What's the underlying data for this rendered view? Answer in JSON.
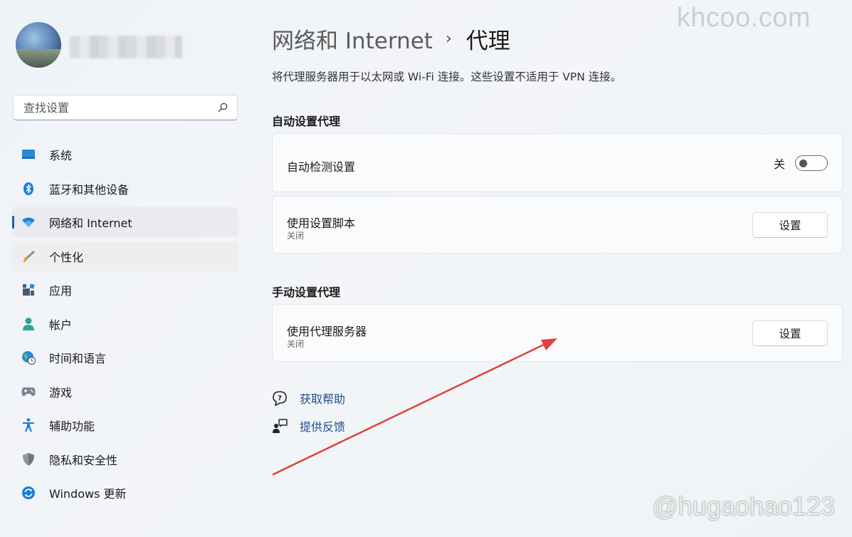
{
  "watermarks": {
    "top": "khcoo.com",
    "bottom": "@hugaohao123"
  },
  "search": {
    "placeholder": "查找设置"
  },
  "sidebar": {
    "items": [
      {
        "label": "系统",
        "icon": "monitor-icon"
      },
      {
        "label": "蓝牙和其他设备",
        "icon": "bluetooth-icon"
      },
      {
        "label": "网络和 Internet",
        "icon": "wifi-icon",
        "selected": true
      },
      {
        "label": "个性化",
        "icon": "brush-icon"
      },
      {
        "label": "应用",
        "icon": "apps-icon"
      },
      {
        "label": "帐户",
        "icon": "account-icon"
      },
      {
        "label": "时间和语言",
        "icon": "globe-clock-icon"
      },
      {
        "label": "游戏",
        "icon": "gamepad-icon"
      },
      {
        "label": "辅助功能",
        "icon": "accessibility-icon"
      },
      {
        "label": "隐私和安全性",
        "icon": "shield-icon"
      },
      {
        "label": "Windows 更新",
        "icon": "update-icon"
      }
    ]
  },
  "header": {
    "parent": "网络和 Internet",
    "separator": "›",
    "current": "代理"
  },
  "description": "将代理服务器用于以太网或 Wi-Fi 连接。这些设置不适用于 VPN 连接。",
  "auto_section": {
    "title": "自动设置代理",
    "detect": {
      "label": "自动检测设置",
      "state_label": "关",
      "on": false
    },
    "script": {
      "label": "使用设置脚本",
      "sub": "关闭",
      "button": "设置"
    }
  },
  "manual_section": {
    "title": "手动设置代理",
    "proxy": {
      "label": "使用代理服务器",
      "sub": "关闭",
      "button": "设置"
    }
  },
  "links": {
    "help": "获取帮助",
    "feedback": "提供反馈"
  },
  "colors": {
    "accent": "#1f5fa8",
    "link": "#1f4e8c",
    "annotation_arrow": "#e0413a"
  }
}
